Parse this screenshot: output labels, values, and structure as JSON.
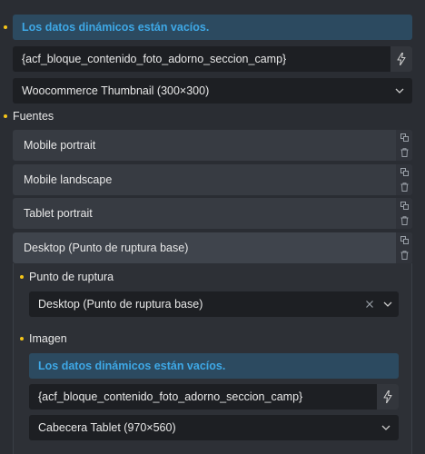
{
  "top": {
    "notice": "Los datos dinámicos están vacíos.",
    "dynamic_tag": "{acf_bloque_contenido_foto_adorno_seccion_camp}",
    "size_select": "Woocommerce Thumbnail (300×300)"
  },
  "sources": {
    "label": "Fuentes",
    "items": [
      {
        "label": "Mobile portrait"
      },
      {
        "label": "Mobile landscape"
      },
      {
        "label": "Tablet portrait"
      },
      {
        "label": "Desktop (Punto de ruptura base)"
      }
    ]
  },
  "breakpoint": {
    "label": "Punto de ruptura",
    "value": "Desktop (Punto de ruptura base)"
  },
  "image": {
    "label": "Imagen",
    "notice": "Los datos dinámicos están vacíos.",
    "dynamic_tag": "{acf_bloque_contenido_foto_adorno_seccion_camp}",
    "size_select": "Cabecera Tablet (970×560)"
  },
  "colors": {
    "accent_dot": "#f5c518",
    "notice_text": "#3ea8e6",
    "notice_bg": "#2c4a60"
  }
}
